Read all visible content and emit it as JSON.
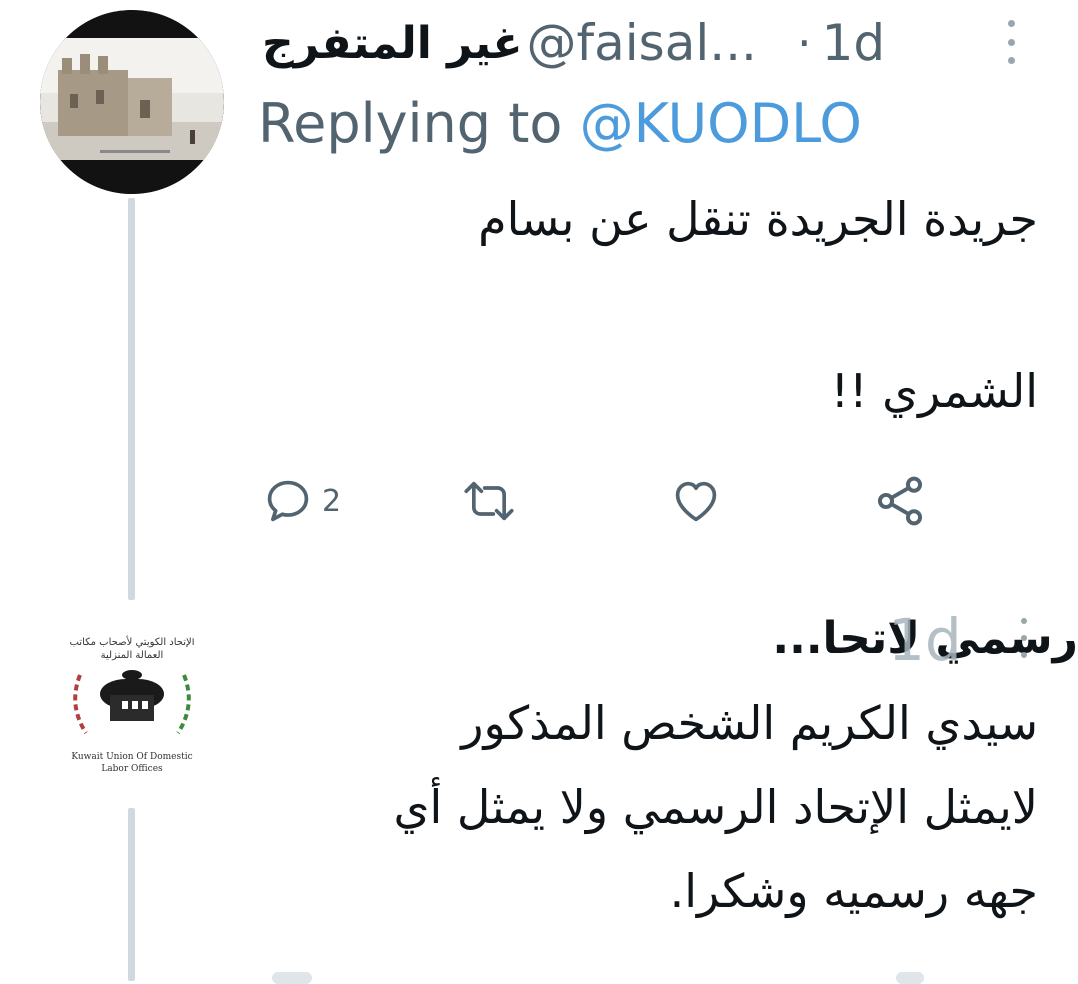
{
  "tweet1": {
    "display_name": "غير المتفرج",
    "handle": "@faisal...",
    "separator": "·",
    "time": "1d",
    "replying_prefix": "Replying to",
    "replying_mention": "@KUODLO",
    "text_lines": [
      "جريدة الجريدة تنقل عن بسام",
      "الشمري !!"
    ],
    "actions": {
      "reply_count": "2",
      "retweet_count": "",
      "like_count": ""
    },
    "avatar_icon": "historic-building-photo"
  },
  "tweet2": {
    "display_name": "رسمي لاتحا...",
    "time": "1d",
    "text_lines": [
      "سيدي الكريم الشخص المذكور",
      "لايمثل الإتحاد الرسمي ولا يمثل أي",
      "جهه رسميه وشكرا."
    ],
    "avatar": {
      "logo_text_ar_1": "الإتحاد الكويتي لأصحاب مكاتب",
      "logo_text_ar_2": "العمالة المنزلية",
      "logo_text_en_1": "Kuwait Union Of Domestic",
      "logo_text_en_2": "Labor Offices"
    }
  },
  "colors": {
    "text_primary": "#0f1419",
    "text_secondary": "#536471",
    "link": "#4c9bdc",
    "thread_line": "#cfd9de"
  }
}
